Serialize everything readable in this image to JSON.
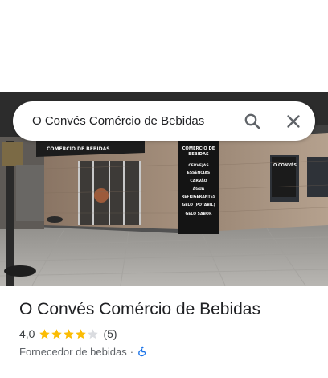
{
  "search": {
    "query": "O Convés Comércio de Bebidas"
  },
  "place": {
    "name": "O Convés Comércio de Bebidas",
    "rating": "4,0",
    "rating_value": 4.0,
    "review_count": "(5)",
    "category": "Fornecedor de bebidas",
    "separator": "·"
  },
  "photo": {
    "sign_lines": [
      "COMÉRCIO DE",
      "BEBIDAS",
      "CERVEJAS",
      "ESSÊNCIAS",
      "CARVÃO",
      "ÁGUA",
      "REFRIGERANTES",
      "GELO (POTABIL)",
      "GELO SABOR"
    ],
    "store_front_text": "COMÉRCIO DE BEBIDAS",
    "side_sign_line": "O CONVÉS"
  },
  "icons": {
    "search": "search-icon",
    "close": "close-icon",
    "star": "star-icon",
    "accessibility": "wheelchair-accessible-icon"
  },
  "colors": {
    "star_filled": "#fbbc04",
    "star_empty": "#dadce0",
    "accessibility_blue": "#1a73e8",
    "text_primary": "#202124",
    "text_secondary": "#5f6368"
  }
}
